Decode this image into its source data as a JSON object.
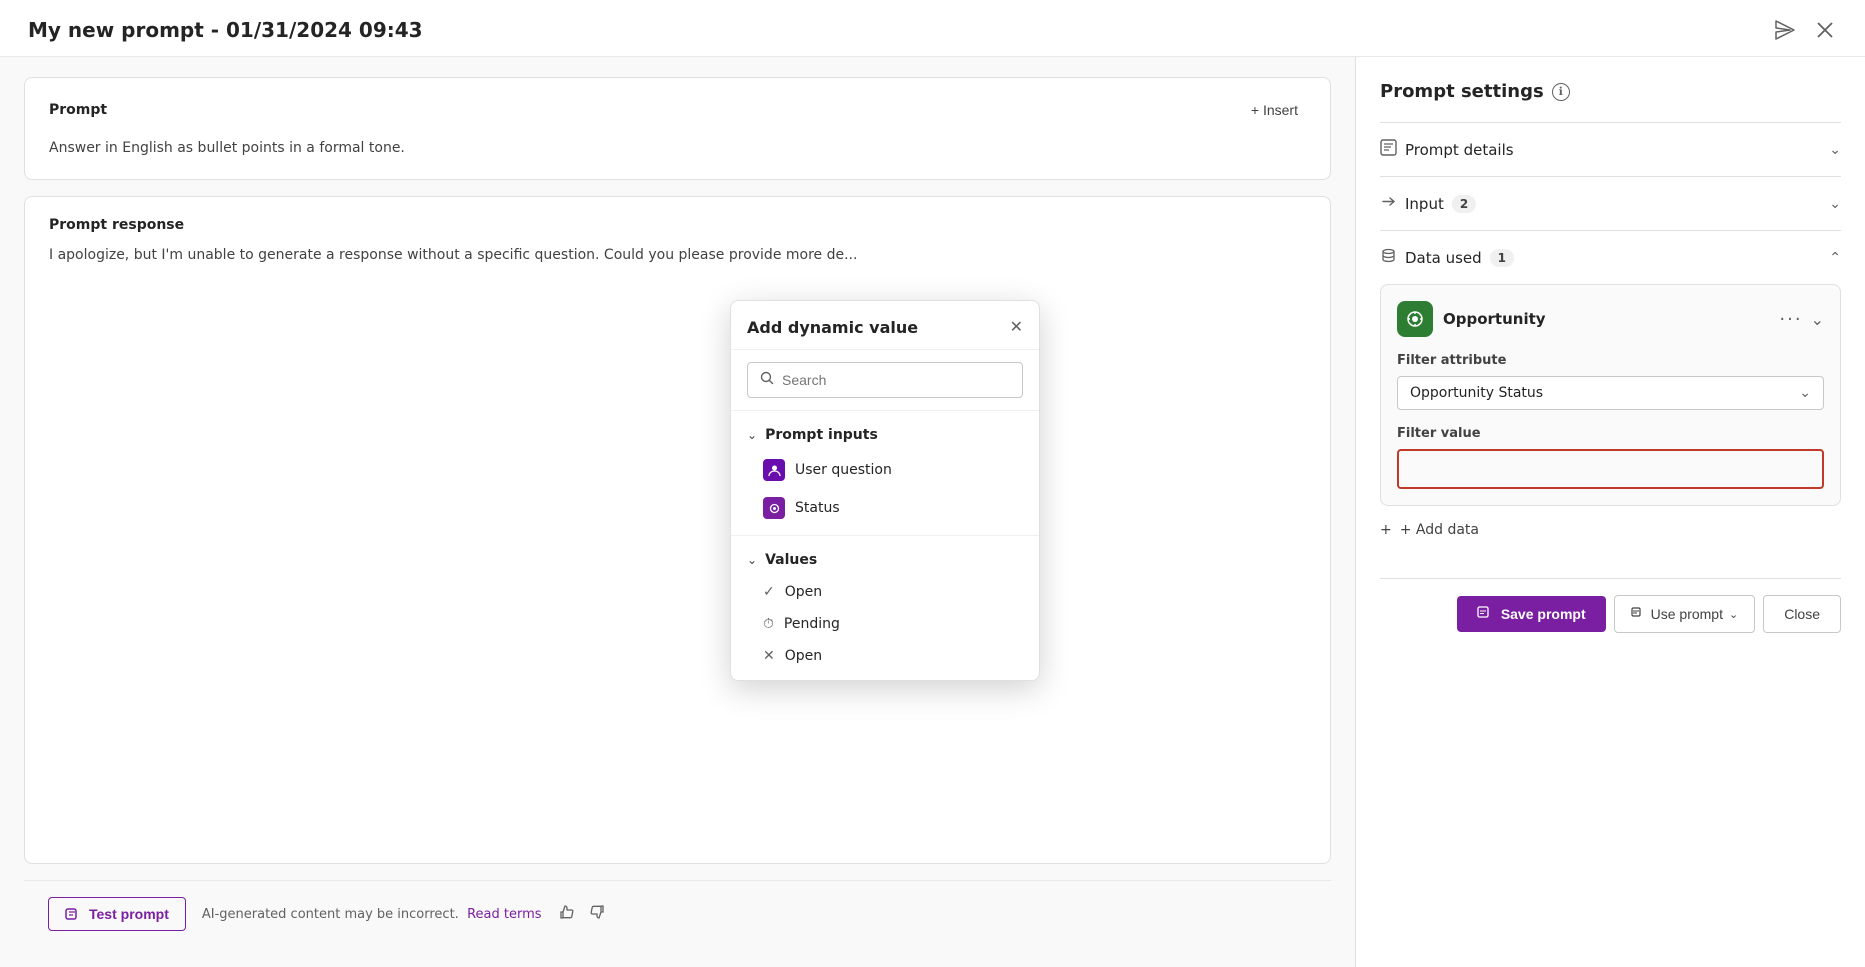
{
  "window": {
    "title": "My new prompt - 01/31/2024 09:43"
  },
  "titleBar": {
    "send_icon": "✉",
    "close_icon": "✕"
  },
  "leftPanel": {
    "promptCard": {
      "title": "Prompt",
      "insert_label": "+ Insert",
      "body_text": "Answer in English as bullet points in a formal tone."
    },
    "responseCard": {
      "title": "Prompt response",
      "body_text": "I apologize, but I'm unable to generate a response without a specific question. Could you please provide more de..."
    },
    "footer": {
      "test_prompt_label": "Test prompt",
      "disclaimer": "AI-generated content may be incorrect.",
      "read_terms_label": "Read terms"
    }
  },
  "rightPanel": {
    "title": "Prompt settings",
    "sections": [
      {
        "id": "prompt-details",
        "icon": "📋",
        "label": "Prompt details",
        "badge": null,
        "expanded": false
      },
      {
        "id": "input",
        "icon": "→",
        "label": "Input",
        "badge": "2",
        "expanded": false
      },
      {
        "id": "data-used",
        "icon": "🗄",
        "label": "Data used",
        "badge": "1",
        "expanded": true
      }
    ],
    "dataUsed": {
      "opportunityName": "Opportunity",
      "filterAttributeLabel": "Filter attribute",
      "filterAttributeValue": "Opportunity Status",
      "filterValueLabel": "Filter value",
      "filterValuePlaceholder": "",
      "addDataLabel": "+ Add data"
    },
    "footer": {
      "save_label": "Save prompt",
      "use_label": "Use prompt",
      "close_label": "Close"
    }
  },
  "popup": {
    "title": "Add dynamic value",
    "search": {
      "placeholder": "Search"
    },
    "promptInputsSection": {
      "label": "Prompt inputs",
      "items": [
        {
          "label": "User question",
          "icon": "🔷",
          "iconColor": "#6A0DAD"
        },
        {
          "label": "Status",
          "icon": "🔷",
          "iconColor": "#7B1FA2"
        }
      ]
    },
    "valuesSection": {
      "label": "Values",
      "items": [
        {
          "label": "Open",
          "icon": "✓",
          "type": "check"
        },
        {
          "label": "Pending",
          "icon": "⏱",
          "type": "clock"
        },
        {
          "label": "Open",
          "icon": "✕",
          "type": "x"
        }
      ]
    }
  }
}
